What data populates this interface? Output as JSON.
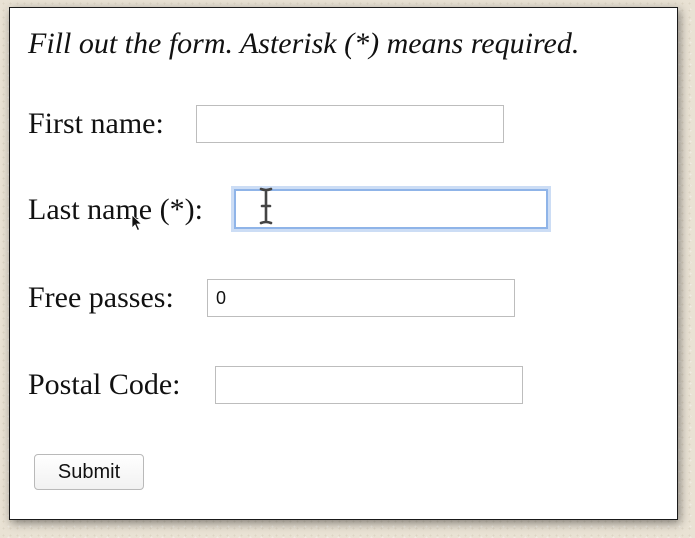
{
  "form": {
    "instructions": "Fill out the form. Asterisk (*) means required.",
    "fields": [
      {
        "label": "First name:",
        "value": "",
        "required": false
      },
      {
        "label": "Last name (*):",
        "value": "",
        "required": true,
        "focused": true
      },
      {
        "label": "Free passes:",
        "value": "0",
        "required": false
      },
      {
        "label": "Postal Code:",
        "value": "",
        "required": false
      }
    ],
    "submit_label": "Submit"
  },
  "colors": {
    "background": "#e9e2d4",
    "panel": "#ffffff",
    "focus_ring": "#8fb4e8",
    "field_border": "#bdbdbd"
  },
  "cursors": [
    "text-cursor-icon",
    "arrow-cursor-icon"
  ]
}
